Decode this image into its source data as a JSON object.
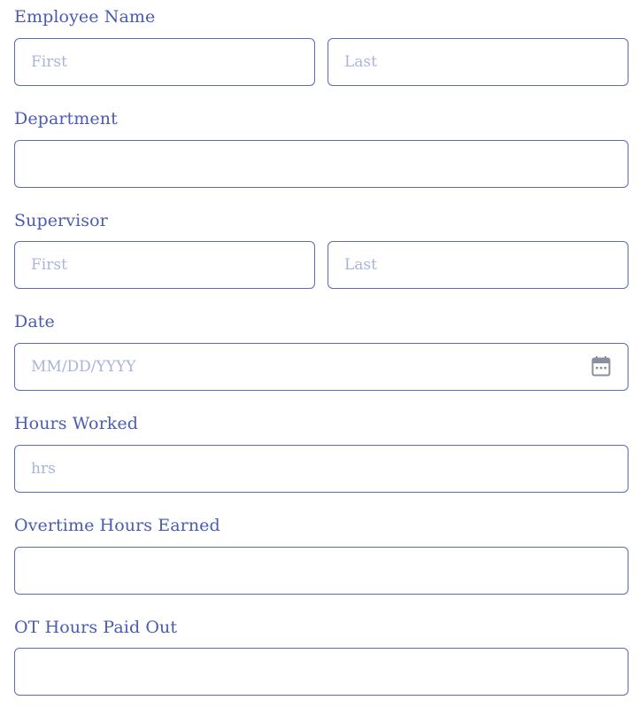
{
  "employee_name": {
    "label": "Employee Name",
    "first_placeholder": "First",
    "last_placeholder": "Last"
  },
  "department": {
    "label": "Department",
    "placeholder": ""
  },
  "supervisor": {
    "label": "Supervisor",
    "first_placeholder": "First",
    "last_placeholder": "Last"
  },
  "date": {
    "label": "Date",
    "placeholder": "MM/DD/YYYY",
    "icon": "calendar-icon"
  },
  "hours_worked": {
    "label": "Hours Worked",
    "placeholder": "hrs"
  },
  "overtime_hours_earned": {
    "label": "Overtime Hours Earned",
    "placeholder": ""
  },
  "ot_hours_paid_out": {
    "label": "OT Hours Paid Out",
    "placeholder": ""
  },
  "colors": {
    "label": "#4a5bb0",
    "border": "#5b6bb8",
    "placeholder": "#aab3dc",
    "icon": "#8a8f9e"
  }
}
